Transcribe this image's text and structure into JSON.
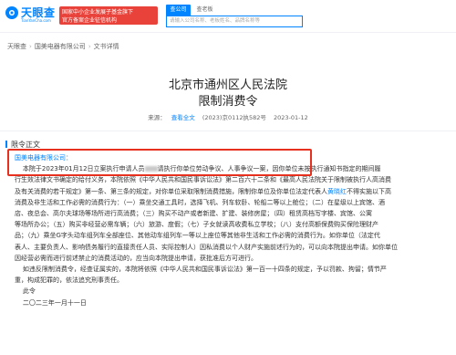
{
  "header": {
    "logo_text": "天眼查",
    "logo_sub": "TianYanCha.com",
    "promo_line1": "国家中小企业发展子基金旗下",
    "promo_line2": "官方备案企业征信机构",
    "promo_tag": "",
    "tabs": [
      "查公司",
      "查老板"
    ],
    "search_placeholder": "请输入公司名称、老板姓名、品牌名称等"
  },
  "breadcrumb": {
    "items": [
      "天眼查",
      "国美电器有限公司",
      "文书详情"
    ]
  },
  "document": {
    "title_line1": "北京市通州区人民法院",
    "title_line2": "限制消费令",
    "meta_view": "查看全文",
    "meta_case": "(2023)京0112执582号",
    "meta_date": "2023-01-12",
    "section_heading": "限令正文",
    "lines": [
      {
        "a": "国美电器有限公司：",
        "b": ""
      },
      {
        "a": "本院于2023年01月12日立案执行申请人员",
        "b": "请执行你单位劳动争议、人事争议一案，因你单位未按执行通知书指定的期间履"
      },
      {
        "a": "行生效法律文书确定的给付义务，本院依照《中华人民共和国民事诉讼法》第二百六十二条和《最高人民法院关于限制被执行人高消费",
        "b": ""
      },
      {
        "a": "及有关消费的若干规定》第一条、第三条的规定，对你单位采取限制消费措施，限制你单位及你单位法定代表人",
        "b": "不得实施以下高"
      },
      {
        "a": "消费及非生活和工作必需的消费行为：（一）乘坐交通工具时，选择飞机、列车软卧、轮船二等以上舱位；（二）在星级以上宾馆、酒",
        "b": ""
      },
      {
        "a": "店、夜总会、高尔夫球场等场所进行高消费；（三）购买不动产或者新建、扩建、装修房屋；（四）租赁高档写字楼、宾馆、公寓",
        "b": ""
      },
      {
        "a": "等场所办公；（五）购买非经营必需车辆；（六）旅游、度假；（七）子女就读高收费私立学校；（八）支付高额保费购买保险理财产",
        "b": ""
      },
      {
        "a": "品；（九）乘坐G字头动车组列车全部座位、其他动车组列车一等以上座位等其他非生活和工作必需的消费行为。如你单位（法定代",
        "b": ""
      },
      {
        "a": "表人、主要负责人、影响债务履行的直接责任人员、实际控制人）因私消费以个人财产实施前述行为的，可以向本院提出申请。如你单位",
        "b": ""
      },
      {
        "a": "因经营必需而进行前述禁止的消费活动的，应当向本院提出申请，获批准后方可进行。",
        "b": ""
      },
      {
        "a": "如违反限制消费令，经查证属实的，本院将依照《中华人民共和国民事诉讼法》第一百一十四条的规定，予以罚款、拘留；情节严",
        "b": ""
      },
      {
        "a": "重，构成犯罪的，依法追究刑事责任。",
        "b": ""
      },
      {
        "a": "此令",
        "b": ""
      },
      {
        "a": "二〇二三年一月十一日",
        "b": ""
      }
    ],
    "legal_rep": "黄晓红"
  },
  "colors": {
    "brand": "#0084ff",
    "promo_red": "#e8423a",
    "highlight_red": "#e8301f"
  }
}
